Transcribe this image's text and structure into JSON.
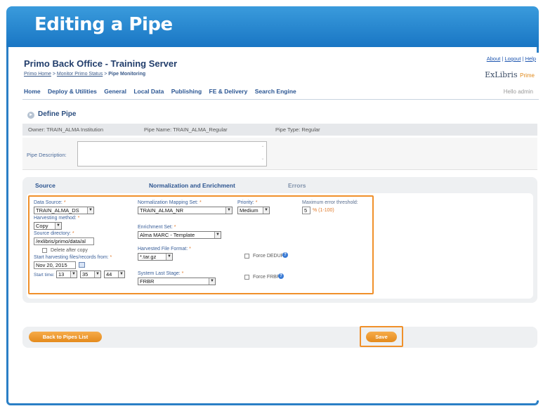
{
  "slide": {
    "title": "Editing a Pipe"
  },
  "header": {
    "app_title": "Primo Back Office - Training Server",
    "breadcrumb": {
      "home": "Primo Home",
      "sep": ">",
      "status": "Monitor Primo Status",
      "current": "Pipe Monitoring"
    },
    "links": {
      "about": "About",
      "logout": "Logout",
      "help": "Help",
      "sep": "|"
    },
    "logo": {
      "brand": "ExLibris",
      "product": "Prime"
    },
    "hello": "Hello admin"
  },
  "nav": {
    "items": [
      "Home",
      "Deploy & Utilities",
      "General",
      "Local Data",
      "Publishing",
      "FE & Delivery",
      "Search Engine"
    ]
  },
  "section": {
    "title": "Define Pipe"
  },
  "info": {
    "owner": "Owner: TRAIN_ALMA Institution",
    "pipe_name": "Pipe Name: TRAIN_ALMA_Regular",
    "pipe_type": "Pipe Type: Regular"
  },
  "description": {
    "label": "Pipe Description:",
    "value": ""
  },
  "tabs": [
    {
      "label": "Source",
      "active": true
    },
    {
      "label": "Normalization and Enrichment",
      "active": false
    },
    {
      "label": "Errors",
      "active": false
    }
  ],
  "form": {
    "data_source": {
      "label": "Data Source:",
      "value": "TRAIN_ALMA_DS"
    },
    "harvesting_method": {
      "label": "Harvesting method:",
      "value": "Copy"
    },
    "source_directory": {
      "label": "Source directory:",
      "value": "/exlibris/primo/data/al"
    },
    "delete_after_copy": {
      "label": "Delete after copy",
      "checked": false
    },
    "start_harvesting": {
      "label": "Start harvesting files/records from:",
      "value": "Nov 20, 2015"
    },
    "start_time": {
      "label": "Start time:",
      "hour": "13",
      "minute": "35",
      "second": "44"
    },
    "normalization_mapping_set": {
      "label": "Normalization Mapping Set:",
      "value": "TRAIN_ALMA_NR"
    },
    "priority": {
      "label": "Priority:",
      "value": "Medium"
    },
    "enrichment_set": {
      "label": "Enrichment Set:",
      "value": "Alma MARC - Template"
    },
    "harvested_file_format": {
      "label": "Harvested File Format:",
      "value": "*.tar.gz"
    },
    "force_dedup": {
      "label": "Force DEDUP",
      "checked": false
    },
    "system_last_stage": {
      "label": "System Last Stage:",
      "value": "FRBR"
    },
    "force_frbr": {
      "label": "Force FRBR",
      "checked": false
    },
    "max_error_threshold": {
      "label": "Maximum error threshold:",
      "value": "5",
      "hint": "% (1-100)"
    }
  },
  "buttons": {
    "back": "Back to Pipes List",
    "save": "Save"
  },
  "colors": {
    "title_bar": "#1976c4",
    "highlight": "#f0902a",
    "button": "#e48a1c"
  }
}
